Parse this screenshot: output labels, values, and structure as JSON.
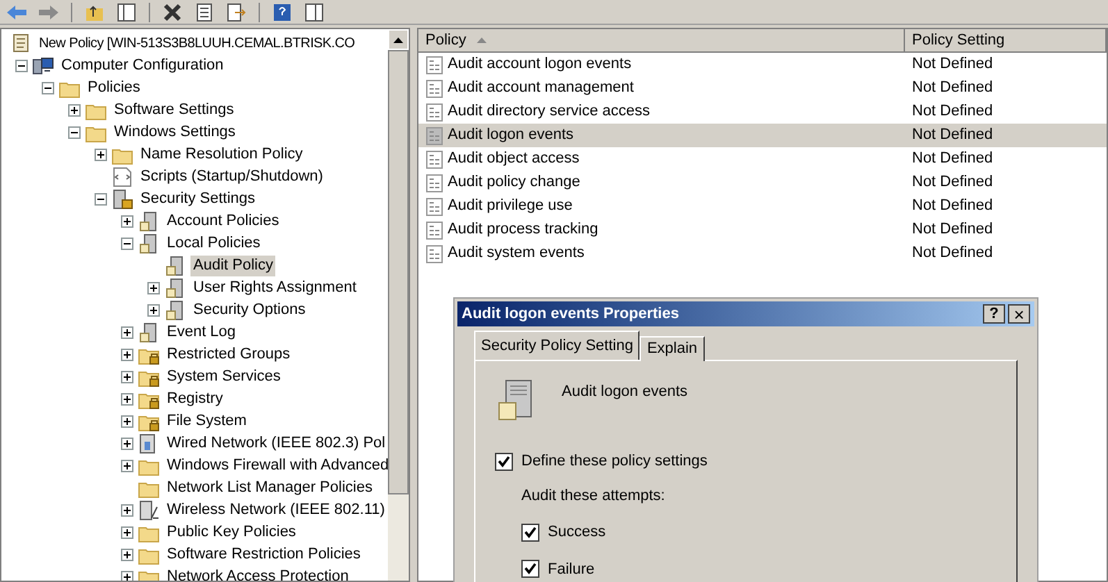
{
  "tree": {
    "root": {
      "label": "New Policy [WIN-513S3B8LUUH.CEMAL.BTRISK.CO",
      "kind": "doc",
      "selected": false,
      "children": [
        {
          "label": "Computer Configuration",
          "kind": "computer",
          "expanded": true,
          "selected": false,
          "children": [
            {
              "label": "Policies",
              "kind": "folder",
              "expanded": true,
              "selected": false,
              "children": [
                {
                  "label": "Software Settings",
                  "kind": "folder",
                  "expanded": false,
                  "selected": false
                },
                {
                  "label": "Windows Settings",
                  "kind": "folder",
                  "expanded": true,
                  "selected": false,
                  "children": [
                    {
                      "label": "Name Resolution Policy",
                      "kind": "folder",
                      "expanded": false,
                      "selected": false
                    },
                    {
                      "label": "Scripts (Startup/Shutdown)",
                      "kind": "script",
                      "selected": false
                    },
                    {
                      "label": "Security Settings",
                      "kind": "security",
                      "expanded": true,
                      "selected": false,
                      "children": [
                        {
                          "label": "Account Policies",
                          "kind": "policy",
                          "expanded": false,
                          "selected": false
                        },
                        {
                          "label": "Local Policies",
                          "kind": "policy",
                          "expanded": true,
                          "selected": false,
                          "children": [
                            {
                              "label": "Audit Policy",
                              "kind": "policy",
                              "selected": true
                            },
                            {
                              "label": "User Rights Assignment",
                              "kind": "policy",
                              "expanded": false,
                              "selected": false
                            },
                            {
                              "label": "Security Options",
                              "kind": "policy",
                              "expanded": false,
                              "selected": false
                            }
                          ]
                        },
                        {
                          "label": "Event Log",
                          "kind": "policy",
                          "expanded": false,
                          "selected": false
                        },
                        {
                          "label": "Restricted Groups",
                          "kind": "lockfolder",
                          "expanded": false,
                          "selected": false
                        },
                        {
                          "label": "System Services",
                          "kind": "lockfolder",
                          "expanded": false,
                          "selected": false
                        },
                        {
                          "label": "Registry",
                          "kind": "lockfolder",
                          "expanded": false,
                          "selected": false
                        },
                        {
                          "label": "File System",
                          "kind": "lockfolder",
                          "expanded": false,
                          "selected": false
                        },
                        {
                          "label": "Wired Network (IEEE 802.3) Pol",
                          "kind": "wired",
                          "expanded": false,
                          "selected": false
                        },
                        {
                          "label": "Windows Firewall with Advanced",
                          "kind": "folder",
                          "expanded": false,
                          "selected": false
                        },
                        {
                          "label": "Network List Manager Policies",
                          "kind": "folder",
                          "selected": false
                        },
                        {
                          "label": "Wireless Network (IEEE 802.11)",
                          "kind": "wireless",
                          "expanded": false,
                          "selected": false
                        },
                        {
                          "label": "Public Key Policies",
                          "kind": "folder",
                          "expanded": false,
                          "selected": false
                        },
                        {
                          "label": "Software Restriction Policies",
                          "kind": "folder",
                          "expanded": false,
                          "selected": false
                        },
                        {
                          "label": "Network Access Protection",
                          "kind": "folder",
                          "expanded": false,
                          "selected": false
                        }
                      ]
                    }
                  ]
                }
              ]
            }
          ]
        }
      ]
    }
  },
  "list": {
    "columns": [
      {
        "label": "Policy",
        "sorted": true
      },
      {
        "label": "Policy Setting",
        "sorted": false
      }
    ],
    "rows": [
      {
        "policy": "Audit account logon events",
        "setting": "Not Defined",
        "selected": false
      },
      {
        "policy": "Audit account management",
        "setting": "Not Defined",
        "selected": false
      },
      {
        "policy": "Audit directory service access",
        "setting": "Not Defined",
        "selected": false
      },
      {
        "policy": "Audit logon events",
        "setting": "Not Defined",
        "selected": true
      },
      {
        "policy": "Audit object access",
        "setting": "Not Defined",
        "selected": false
      },
      {
        "policy": "Audit policy change",
        "setting": "Not Defined",
        "selected": false
      },
      {
        "policy": "Audit privilege use",
        "setting": "Not Defined",
        "selected": false
      },
      {
        "policy": "Audit process tracking",
        "setting": "Not Defined",
        "selected": false
      },
      {
        "policy": "Audit system events",
        "setting": "Not Defined",
        "selected": false
      }
    ]
  },
  "dialog": {
    "title": "Audit logon events Properties",
    "help": "?",
    "close": "×",
    "tabs": [
      {
        "label": "Security Policy Setting",
        "selected": true
      },
      {
        "label": "Explain",
        "selected": false
      }
    ],
    "policy_name": "Audit logon events",
    "define": {
      "label": "Define these policy settings",
      "checked": true
    },
    "attempts_label": "Audit these attempts:",
    "attempts": [
      {
        "label": "Success",
        "checked": true
      },
      {
        "label": "Failure",
        "checked": true
      }
    ]
  }
}
